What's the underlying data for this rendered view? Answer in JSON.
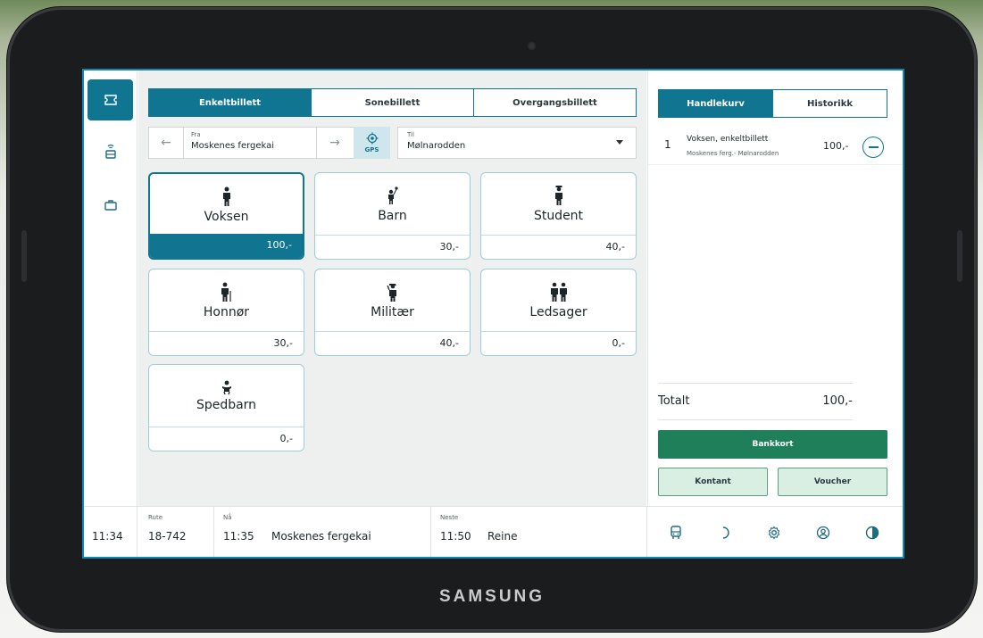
{
  "device": {
    "brand": "SAMSUNG"
  },
  "leftnav": {
    "items": [
      {
        "icon": "ticket-icon",
        "active": true
      },
      {
        "icon": "printer-icon",
        "active": false
      },
      {
        "icon": "briefcase-icon",
        "active": false
      }
    ]
  },
  "ticket_tabs": [
    {
      "label": "Enkeltbillett",
      "active": true
    },
    {
      "label": "Sonebillett",
      "active": false
    },
    {
      "label": "Overgangsbillett",
      "active": false
    }
  ],
  "route": {
    "from_label": "Fra",
    "from_value": "Moskenes fergekai",
    "gps_label": "GPS",
    "to_label": "Til",
    "to_value": "Mølnarodden"
  },
  "passenger_types": [
    {
      "name": "Voksen",
      "price": "100,-",
      "selected": true,
      "icon": "adult-icon"
    },
    {
      "name": "Barn",
      "price": "30,-",
      "selected": false,
      "icon": "child-icon"
    },
    {
      "name": "Student",
      "price": "40,-",
      "selected": false,
      "icon": "student-icon"
    },
    {
      "name": "Honnør",
      "price": "30,-",
      "selected": false,
      "icon": "senior-icon"
    },
    {
      "name": "Militær",
      "price": "40,-",
      "selected": false,
      "icon": "military-icon"
    },
    {
      "name": "Ledsager",
      "price": "0,-",
      "selected": false,
      "icon": "companion-icon"
    },
    {
      "name": "Spedbarn",
      "price": "0,-",
      "selected": false,
      "icon": "infant-icon"
    }
  ],
  "cart_tabs": [
    {
      "label": "Handlekurv",
      "active": true
    },
    {
      "label": "Historikk",
      "active": false
    }
  ],
  "cart": {
    "items": [
      {
        "qty": "1",
        "title": "Voksen, enkeltbillett",
        "subtitle": "Moskenes ferg.- Mølnarodden",
        "price": "100,-"
      }
    ],
    "total_label": "Totalt",
    "total_value": "100,-"
  },
  "payment": {
    "primary": "Bankkort",
    "cash": "Kontant",
    "voucher": "Voucher"
  },
  "footer": {
    "clock": "11:34",
    "route_label": "Rute",
    "route_value": "18-742",
    "now_label": "Nå",
    "now_time": "11:35",
    "now_stop": "Moskenes fergekai",
    "next_label": "Neste",
    "next_time": "11:50",
    "next_stop": "Reine",
    "icons": [
      "bus-icon",
      "moon-icon",
      "gear-icon",
      "user-circle-icon",
      "contrast-icon"
    ]
  },
  "colors": {
    "accent": "#0f7591",
    "pay_primary": "#1f7f5a",
    "pay_secondary": "#d9efe3",
    "screen_border": "#0f87b8"
  }
}
